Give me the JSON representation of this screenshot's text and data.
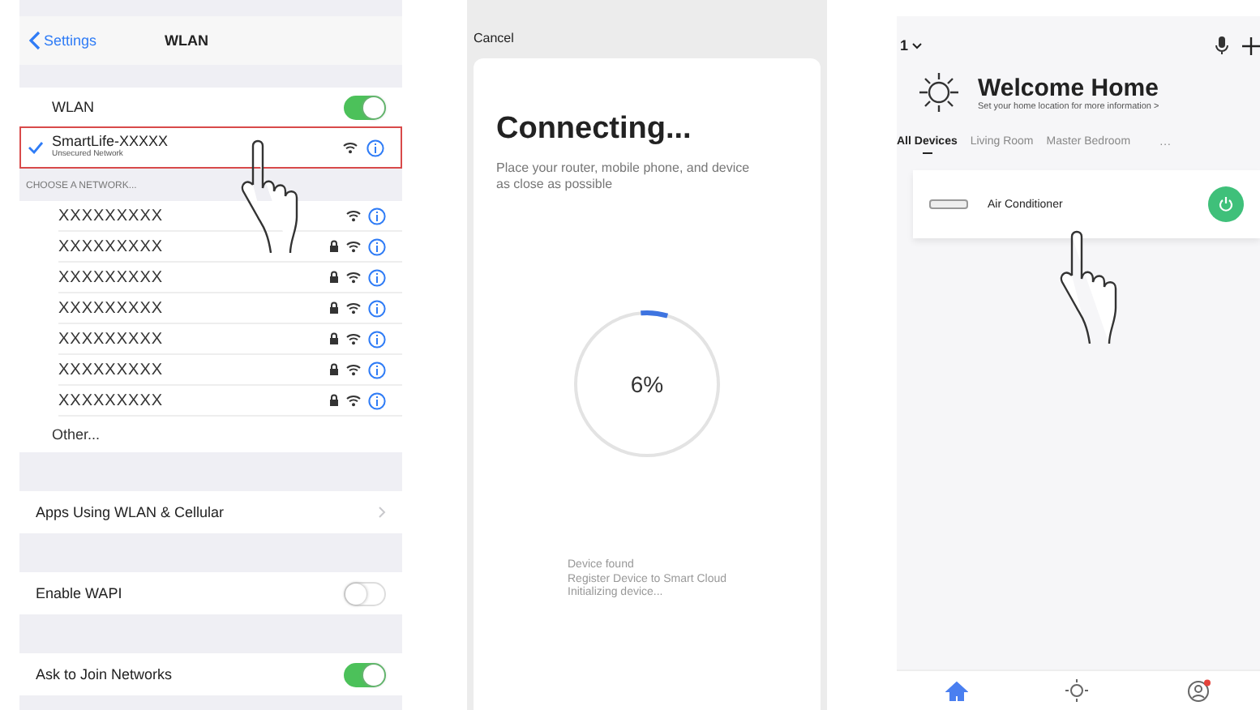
{
  "wlan_screen": {
    "back_label": "Settings",
    "title": "WLAN",
    "wlan_toggle": {
      "label": "WLAN",
      "on": true
    },
    "connected_network": {
      "name": "SmartLife-XXXXX",
      "status": "Unsecured Network",
      "connected": true
    },
    "section_header": "CHOOSE A NETWORK...",
    "networks": [
      {
        "name": "XXXXXXXXX",
        "locked": false
      },
      {
        "name": "XXXXXXXXX",
        "locked": true
      },
      {
        "name": "XXXXXXXXX",
        "locked": true
      },
      {
        "name": "XXXXXXXXX",
        "locked": true
      },
      {
        "name": "XXXXXXXXX",
        "locked": true
      },
      {
        "name": "XXXXXXXXX",
        "locked": true
      },
      {
        "name": "XXXXXXXXX",
        "locked": true
      }
    ],
    "other": "Other...",
    "settings": [
      {
        "kind": "link",
        "label": "Apps Using WLAN & Cellular"
      },
      {
        "kind": "toggle",
        "label": "Enable WAPI",
        "on": false
      },
      {
        "kind": "toggle",
        "label": "Ask to Join Networks",
        "on": true
      }
    ]
  },
  "connecting_screen": {
    "cancel": "Cancel",
    "title": "Connecting...",
    "subtitle": "Place your router, mobile phone, and device as close as possible",
    "progress": {
      "level": 0.06,
      "reading": "6%"
    },
    "steps": [
      "Device found",
      "Register Device to Smart Cloud",
      "Initializing device..."
    ]
  },
  "home_screen": {
    "home_selector": "1",
    "title": "Welcome Home",
    "subtitle": "Set your home location for more information >",
    "tabs": [
      {
        "label": "All Devices",
        "selected": true
      },
      {
        "label": "Living Room",
        "selected": false
      },
      {
        "label": "Master Bedroom",
        "selected": false
      }
    ],
    "more": "···",
    "devices": [
      {
        "name": "Air Conditioner",
        "on": true
      }
    ],
    "nav": [
      {
        "kind": "home",
        "selected": true
      },
      {
        "kind": "scene",
        "selected": false
      },
      {
        "kind": "profile",
        "selected": false,
        "badge": true
      }
    ]
  }
}
